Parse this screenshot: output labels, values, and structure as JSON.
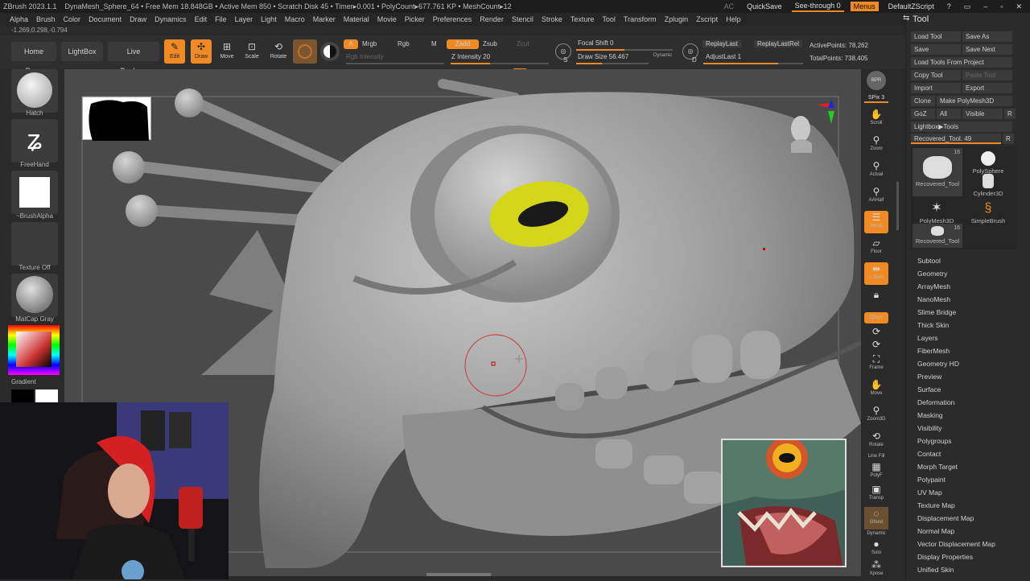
{
  "titlebar": {
    "app_title": "ZBrush 2023.1.1",
    "status": "DynaMesh_Sphere_64  • Free Mem 18.848GB • Active Mem 850 • Scratch Disk 45 • Timer▸0.001 • PolyCount▸677.761 KP • MeshCount▸12",
    "ac": "AC",
    "quicksave": "QuickSave",
    "see_through": "See-through  0",
    "menus": "Menus",
    "script": "DefaultZScript"
  },
  "menubar": {
    "items": [
      "Alpha",
      "Brush",
      "Color",
      "Document",
      "Draw",
      "Dynamics",
      "Edit",
      "File",
      "Layer",
      "Light",
      "Macro",
      "Marker",
      "Material",
      "Movie",
      "Picker",
      "Preferences",
      "Render",
      "Stencil",
      "Stroke",
      "Texture",
      "Tool",
      "Transform",
      "Zplugin",
      "Zscript",
      "Help"
    ]
  },
  "coords": "-1.269,0.298,-0.794",
  "toolbar": {
    "home_page": "Home Page",
    "lightbox": "LightBox",
    "live_boolean": "Live Boolean",
    "edit": "Edit",
    "draw": "Draw",
    "move": "Move",
    "scale": "Scale",
    "rotate": "Rotate",
    "a": "A",
    "mrgb": "Mrgb",
    "rgb": "Rgb",
    "m": "M",
    "zadd": "Zadd",
    "zsub": "Zsub",
    "zcut": "Zcut",
    "rgb_intensity": "Rgb Intensity",
    "z_intensity": "Z Intensity 20",
    "focal_shift": "Focal Shift 0",
    "draw_size": "Draw Size 56.467",
    "dynamic": "Dynamic",
    "s": "S",
    "d": "D",
    "replay_last": "ReplayLast",
    "replay_last_rel": "ReplayLastRel",
    "adjust_last": "AdjustLast 1",
    "active_points": "ActivePoints: 78,262",
    "total_points": "TotalPoints: 738,405"
  },
  "leftshelf": {
    "hatch": "Hatch",
    "freehand": "FreeHand",
    "brush_alpha": "~BrushAlpha",
    "texture_off": "Texture Off",
    "matcap": "MatCap Gray",
    "gradient": "Gradient"
  },
  "rightshelf": {
    "bpr": "BPR",
    "spix": "SPix 3",
    "scroll": "Scroll",
    "zoom": "Zoom",
    "actual": "Actual",
    "aahalf": "AAHalf",
    "persp": "Persp",
    "floor": "Floor",
    "lsym": "L.Sym",
    "xyz": "Qxyz",
    "frame": "Frame",
    "move": "Move",
    "zoom3d": "Zoom3D",
    "rotate": "Rotate",
    "linefill": "Line Fill",
    "polyf": "PolyF",
    "transp": "Transp",
    "ghost": "Ghost",
    "dynamic": "Dynamic",
    "solo": "Solo",
    "xpose": "Xpose"
  },
  "toolpanel": {
    "title": "Tool",
    "load_tool": "Load Tool",
    "save_as": "Save As",
    "save": "Save",
    "save_next": "Save Next",
    "load_from_project": "Load Tools From Project",
    "copy_tool": "Copy Tool",
    "paste_tool": "Paste Tool",
    "import": "Import",
    "export": "Export",
    "clone": "Clone",
    "make_polymesh": "Make PolyMesh3D",
    "goz": "GoZ",
    "all": "All",
    "visible": "Visible",
    "r": "R",
    "lightbox_tools": "Lightbox▶Tools",
    "recovered_tool": "Recovered_Tool. 49",
    "thumbs": [
      {
        "label": "Recovered_Tool",
        "count": "16"
      },
      {
        "label": "PolySphere",
        "count": ""
      },
      {
        "label": "Cylinder3D",
        "count": ""
      },
      {
        "label": "PolyMesh3D",
        "count": ""
      },
      {
        "label": "SimpleBrush",
        "count": ""
      },
      {
        "label": "Recovered_Tool",
        "count": "16"
      }
    ],
    "subpalettes": [
      "Subtool",
      "Geometry",
      "ArrayMesh",
      "NanoMesh",
      "Slime Bridge",
      "Thick Skin",
      "Layers",
      "FiberMesh",
      "Geometry HD",
      "Preview",
      "Surface",
      "Deformation",
      "Masking",
      "Visibility",
      "Polygroups",
      "Contact",
      "Morph Target",
      "Polypaint",
      "UV Map",
      "Texture Map",
      "Displacement Map",
      "Normal Map",
      "Vector Displacement Map",
      "Display Properties",
      "Unified Skin"
    ]
  },
  "colors": {
    "accent": "#f08a24",
    "model": "#9a9a9a",
    "eye": "#d4d61a"
  }
}
